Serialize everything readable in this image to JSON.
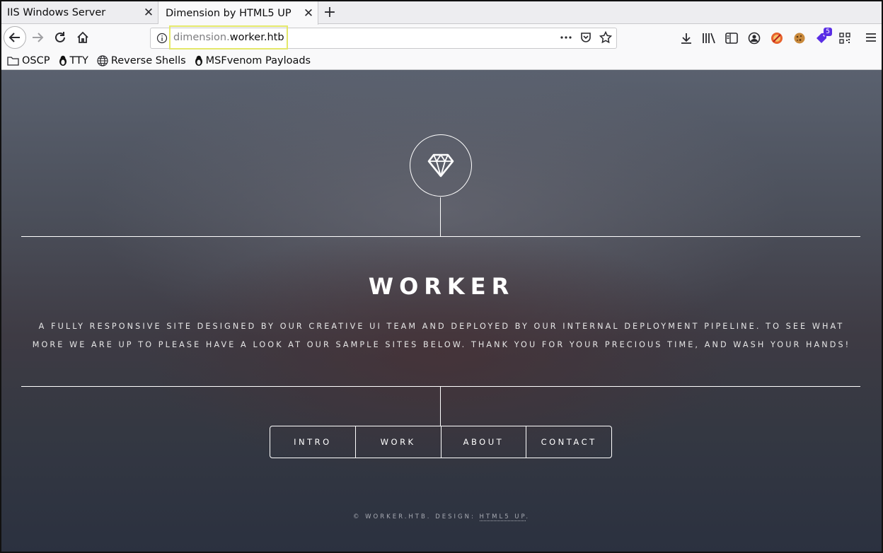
{
  "tabs": [
    {
      "title": "IIS Windows Server",
      "close": "✕"
    },
    {
      "title": "Dimension by HTML5 UP",
      "close": "✕"
    }
  ],
  "new_tab": "+",
  "url": {
    "prefix": "dimension.",
    "host": "worker.htb"
  },
  "toolbar": {
    "badge_count": "5"
  },
  "bookmarks": [
    {
      "label": "OSCP",
      "icon": "folder-icon"
    },
    {
      "label": "TTY",
      "icon": "tux-icon"
    },
    {
      "label": "Reverse Shells",
      "icon": "globe-icon"
    },
    {
      "label": "MSFvenom Payloads",
      "icon": "tux-icon"
    }
  ],
  "site": {
    "title": "WORKER",
    "description": "A fully responsive site designed by our creative UI team and deployed by our internal deployment pipeline. To see what more we are up to please have a look at our sample sites below. Thank you for your precious time, and wash your hands!",
    "nav": [
      "INTRO",
      "WORK",
      "ABOUT",
      "CONTACT"
    ],
    "footer_text": "© WORKER.HTB. DESIGN: ",
    "footer_link": "HTML5 UP",
    "footer_end": "."
  },
  "colors": {
    "url_highlight": "#e4e86a",
    "badge": "#5a2ee5"
  }
}
